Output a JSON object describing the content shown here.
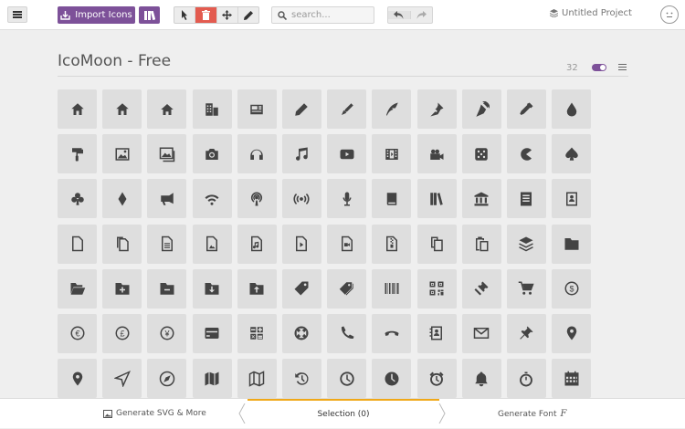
{
  "toolbar": {
    "import_label": "Import Icons",
    "search_placeholder": "search...",
    "project_name": "Untitled Project"
  },
  "set": {
    "title": "IcoMoon - Free",
    "count": "32"
  },
  "footer": {
    "generate_svg": "Generate SVG & More",
    "selection": "Selection (0)",
    "generate_font": "Generate Font"
  },
  "icons": [
    "home",
    "home2",
    "home3",
    "office",
    "newspaper",
    "pencil",
    "pencil2",
    "quill",
    "pen",
    "blog",
    "eyedropper",
    "droplet",
    "paint-format",
    "image",
    "images",
    "camera",
    "headphones",
    "music",
    "play",
    "film",
    "video-camera",
    "dice",
    "pacman",
    "spades",
    "clubs",
    "diamonds",
    "bullhorn",
    "connection",
    "podcast",
    "feed",
    "mic",
    "book",
    "books",
    "library",
    "file-text",
    "profile",
    "file-empty",
    "files-empty",
    "file-text2",
    "file-picture",
    "file-music",
    "file-play",
    "file-video",
    "file-zip",
    "copy",
    "paste",
    "stack",
    "folder",
    "folder-open",
    "folder-plus",
    "folder-minus",
    "folder-download",
    "folder-upload",
    "price-tag",
    "price-tags",
    "barcode",
    "qrcode",
    "ticket",
    "cart",
    "coin-dollar",
    "coin-euro",
    "coin-pound",
    "coin-yen",
    "credit-card",
    "calculator",
    "lifebuoy",
    "phone",
    "phone-hang-up",
    "address-book",
    "envelop",
    "pushpin",
    "location",
    "location2",
    "compass",
    "compass2",
    "map",
    "map2",
    "history",
    "clock",
    "clock2",
    "alarm",
    "bell",
    "stopwatch",
    "calendar"
  ],
  "colors": {
    "accent": "#7d5199",
    "active_tool": "#e35b4f",
    "selection_underline": "#f0a818"
  }
}
